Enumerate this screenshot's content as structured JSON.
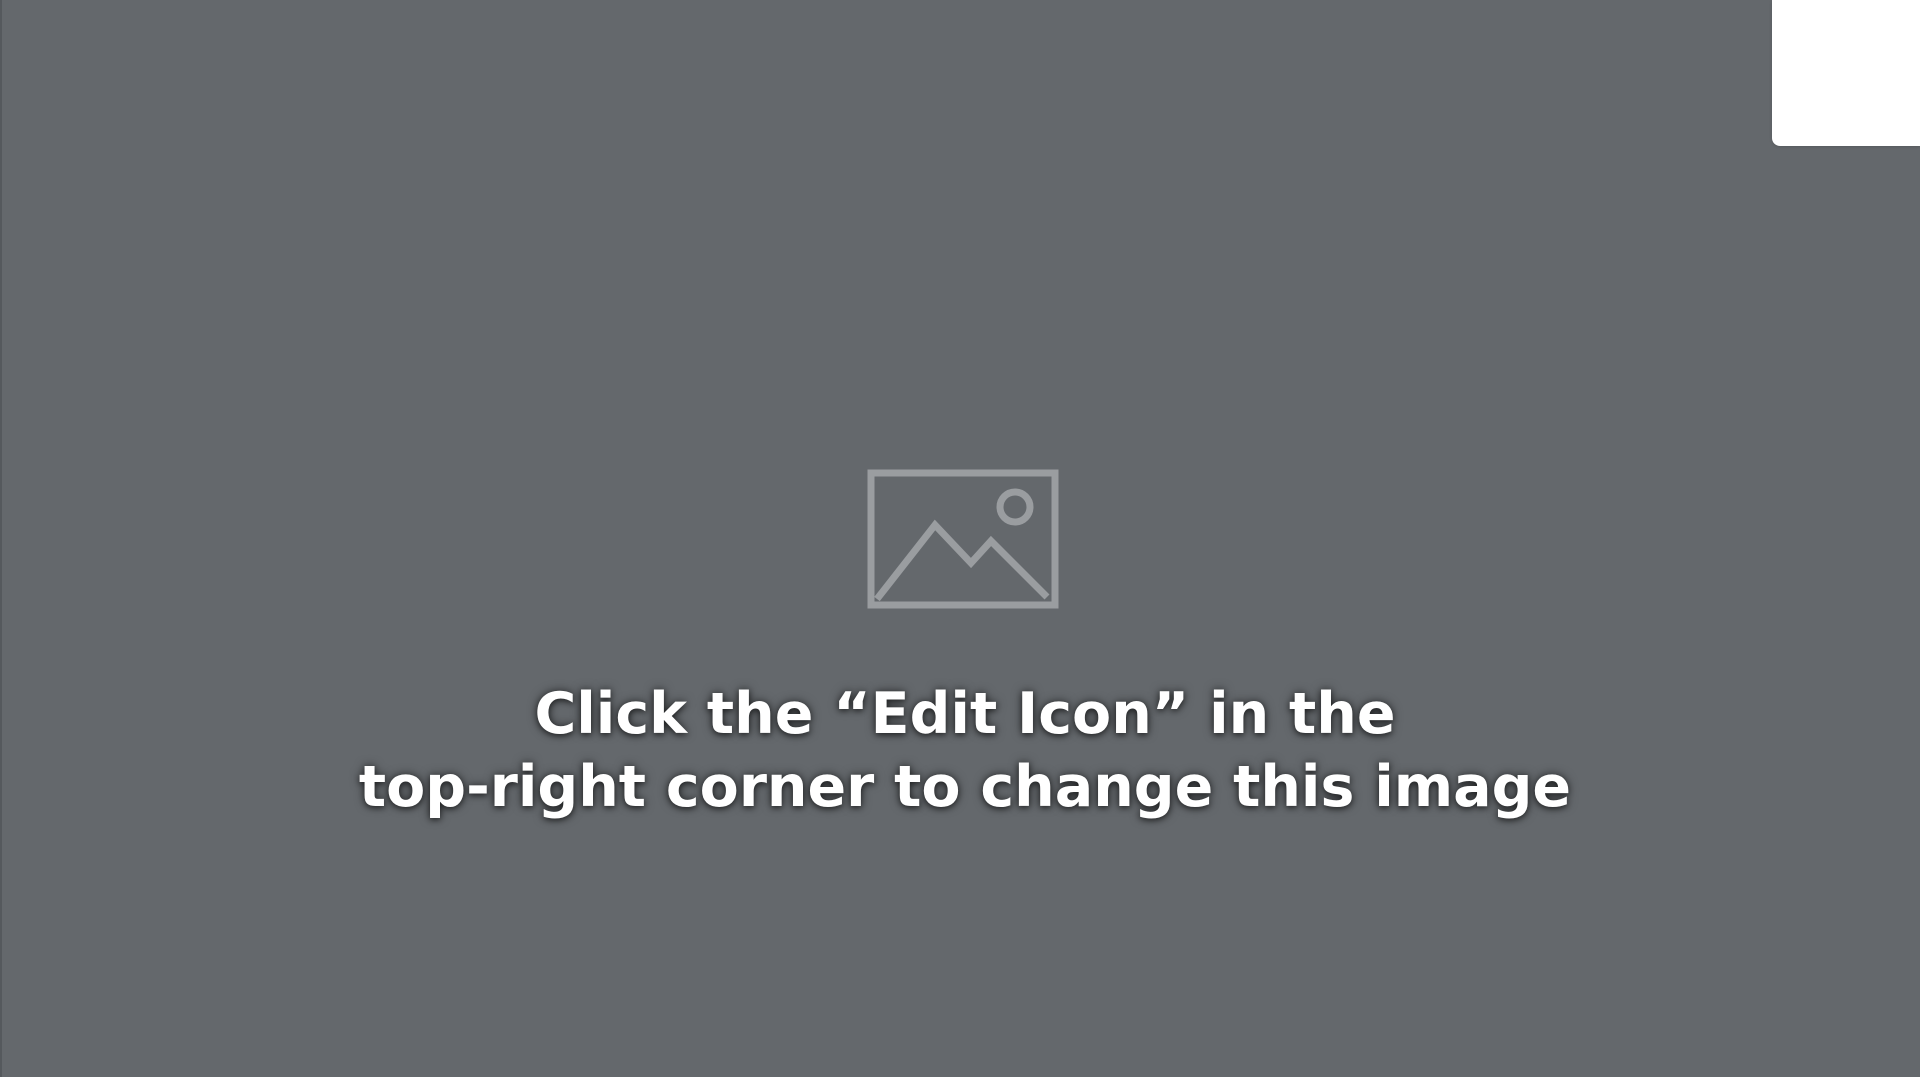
{
  "placeholder": {
    "icon": "image-placeholder-icon",
    "icon_color": "#9a9da0",
    "background_color": "#64686c",
    "caption_lines": [
      "Click the “Edit Icon” in the",
      "top-right corner to change this image"
    ]
  },
  "corner_panel": {
    "color": "#ffffff"
  }
}
